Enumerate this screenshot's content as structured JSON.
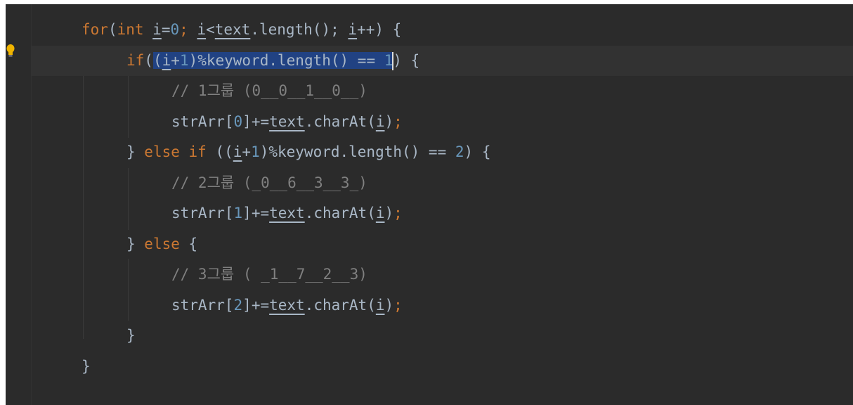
{
  "editor": {
    "lines": [
      {
        "tokens": [
          {
            "t": "for",
            "c": "kw"
          },
          {
            "t": "(",
            "c": ""
          },
          {
            "t": "int ",
            "c": "kw"
          },
          {
            "t": "i",
            "c": "un"
          },
          {
            "t": "=",
            "c": ""
          },
          {
            "t": "0",
            "c": "num"
          },
          {
            "t": "; ",
            "c": "kw"
          },
          {
            "t": "i",
            "c": "un"
          },
          {
            "t": "<",
            "c": ""
          },
          {
            "t": "text",
            "c": "un"
          },
          {
            "t": ".length(); ",
            "c": ""
          },
          {
            "t": "i",
            "c": "un"
          },
          {
            "t": "++) {",
            "c": ""
          }
        ]
      },
      {
        "tokens": [
          {
            "t": "if",
            "c": "kw"
          },
          {
            "t": "(",
            "c": ""
          },
          {
            "t": "(",
            "c": "sel"
          },
          {
            "t": "i",
            "c": "sel un"
          },
          {
            "t": "+",
            "c": "sel"
          },
          {
            "t": "1",
            "c": "sel num"
          },
          {
            "t": ")%keyword.length() == ",
            "c": "sel"
          },
          {
            "t": "1",
            "c": "sel num"
          },
          {
            "t": "",
            "c": "caret"
          },
          {
            "t": ") {",
            "c": ""
          }
        ]
      },
      {
        "tokens": [
          {
            "t": "// 1그룹 (0__0__1__0__)",
            "c": "cm"
          }
        ]
      },
      {
        "tokens": [
          {
            "t": "strArr[",
            "c": ""
          },
          {
            "t": "0",
            "c": "num"
          },
          {
            "t": "]+=",
            "c": ""
          },
          {
            "t": "text",
            "c": "un"
          },
          {
            "t": ".charAt(",
            "c": ""
          },
          {
            "t": "i",
            "c": "un"
          },
          {
            "t": ")",
            "c": ""
          },
          {
            "t": ";",
            "c": "kw"
          }
        ]
      },
      {
        "tokens": [
          {
            "t": "} ",
            "c": ""
          },
          {
            "t": "else if ",
            "c": "kw"
          },
          {
            "t": "((",
            "c": ""
          },
          {
            "t": "i",
            "c": "un"
          },
          {
            "t": "+",
            "c": ""
          },
          {
            "t": "1",
            "c": "num"
          },
          {
            "t": ")%keyword.length() == ",
            "c": ""
          },
          {
            "t": "2",
            "c": "num"
          },
          {
            "t": ") {",
            "c": ""
          }
        ]
      },
      {
        "tokens": [
          {
            "t": "// 2그룹 (_0__6__3__3_)",
            "c": "cm"
          }
        ]
      },
      {
        "tokens": [
          {
            "t": "strArr[",
            "c": ""
          },
          {
            "t": "1",
            "c": "num"
          },
          {
            "t": "]+=",
            "c": ""
          },
          {
            "t": "text",
            "c": "un"
          },
          {
            "t": ".charAt(",
            "c": ""
          },
          {
            "t": "i",
            "c": "un"
          },
          {
            "t": ")",
            "c": ""
          },
          {
            "t": ";",
            "c": "kw"
          }
        ]
      },
      {
        "tokens": [
          {
            "t": "} ",
            "c": ""
          },
          {
            "t": "else ",
            "c": "kw"
          },
          {
            "t": "{",
            "c": ""
          }
        ]
      },
      {
        "tokens": [
          {
            "t": "// 3그룹 ( _1__7__2__3)",
            "c": "cm"
          }
        ]
      },
      {
        "tokens": [
          {
            "t": "strArr[",
            "c": ""
          },
          {
            "t": "2",
            "c": "num"
          },
          {
            "t": "]+=",
            "c": ""
          },
          {
            "t": "text",
            "c": "un"
          },
          {
            "t": ".charAt(",
            "c": ""
          },
          {
            "t": "i",
            "c": "un"
          },
          {
            "t": ")",
            "c": ""
          },
          {
            "t": ";",
            "c": "kw"
          }
        ]
      },
      {
        "tokens": [
          {
            "t": "}",
            "c": ""
          }
        ]
      },
      {
        "tokens": [
          {
            "t": "}",
            "c": ""
          }
        ]
      }
    ]
  },
  "colors": {
    "background": "#2b2b2b",
    "keyword": "#cc7832",
    "number": "#6897bb",
    "comment": "#808080",
    "selection": "#214283",
    "text": "#a9b7c6"
  },
  "icons": {
    "gutter": "lightbulb-icon"
  }
}
